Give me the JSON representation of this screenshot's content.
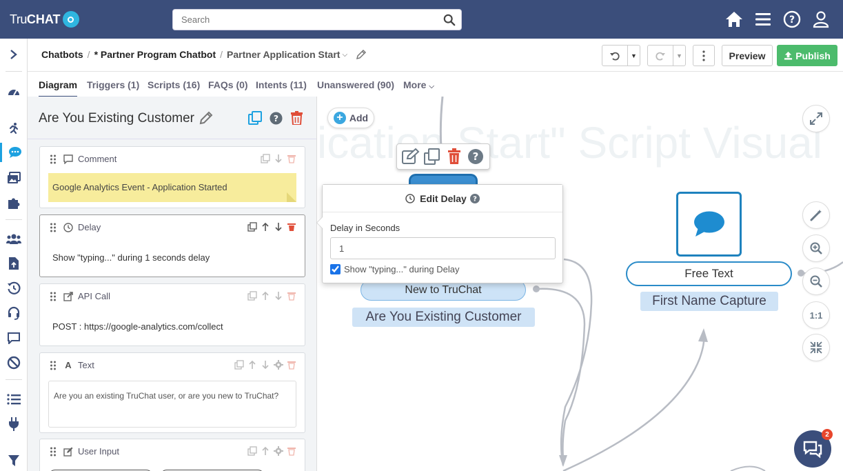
{
  "app": {
    "brand_tru": "Tru",
    "brand_chat": "CHAT"
  },
  "search": {
    "placeholder": "Search"
  },
  "breadcrumb": {
    "chatbots": "Chatbots",
    "chatbot": "* Partner Program Chatbot",
    "script": "Partner Application Start"
  },
  "toolbar": {
    "preview": "Preview",
    "publish": "Publish"
  },
  "tabs": [
    {
      "label": "Diagram"
    },
    {
      "label": "Triggers (1)"
    },
    {
      "label": "Scripts (16)"
    },
    {
      "label": "FAQs (0)"
    },
    {
      "label": "Intents (11)"
    },
    {
      "label": "Unanswered (90)"
    },
    {
      "label": "More"
    }
  ],
  "panel": {
    "title": "Are You Existing Customer",
    "cards": [
      {
        "type": "Comment",
        "body": "Google Analytics Event - Application Started"
      },
      {
        "type": "Delay",
        "body": "Show \"typing...\" during 1 seconds delay"
      },
      {
        "type": "API Call",
        "body": "POST : https://google-analytics.com/collect"
      },
      {
        "type": "Text",
        "body": "Are you an existing TruChat user, or are you new to TruChat?"
      },
      {
        "type": "User Input",
        "body": ""
      }
    ]
  },
  "canvas": {
    "watermark": "ication Start\" Script Visual",
    "add_label": "Add",
    "new_to_truchat": "New to TruChat",
    "existing_label": "Are You Existing Customer",
    "free_text": "Free Text",
    "first_name_label": "First Name Capture",
    "zoom_reset": "1:1",
    "chat_badge": "2"
  },
  "delay_popover": {
    "title": "Edit Delay",
    "field_label": "Delay in Seconds",
    "field_value": "1",
    "checkbox_label": "Show \"typing...\" during Delay",
    "checkbox_checked": true
  },
  "colors": {
    "navbar": "#3b4e7b",
    "accent": "#1da1e0",
    "publish": "#4cbb6c",
    "delete": "#e04e39",
    "sticky": "#f7ec9c"
  }
}
